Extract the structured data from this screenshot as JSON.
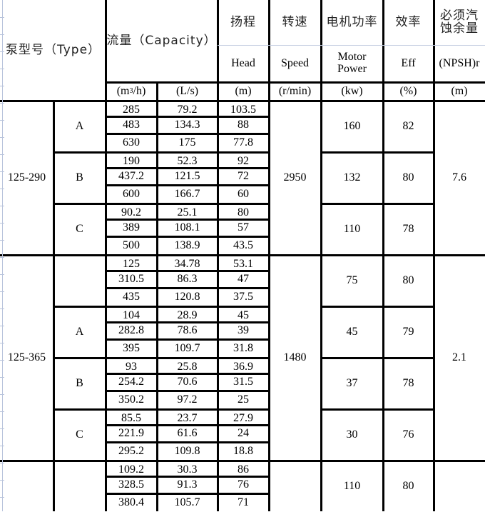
{
  "header": {
    "type_label": "泵型号（Type）",
    "capacity_label": "流量（Capacity）",
    "head_zh": "扬程",
    "speed_zh": "转速",
    "power_zh": "电机功率",
    "eff_zh": "效率",
    "npsh_zh_line1": "必须汽",
    "npsh_zh_line2": "蚀余量",
    "head_en": "Head",
    "speed_en": "Speed",
    "power_en_line1": "Motor",
    "power_en_line2": "Power",
    "eff_en": "Eff",
    "npsh_en": "(NPSH)r",
    "unit_capacity_m3h_pre": "(m",
    "unit_capacity_m3h_sup": "3",
    "unit_capacity_m3h_post": "/h)",
    "unit_capacity_ls": "(L/s)",
    "unit_head": "(m)",
    "unit_speed": "(r/min)",
    "unit_power": "(kw)",
    "unit_eff": "(%)",
    "unit_npsh": "(m)"
  },
  "models": [
    {
      "model": "125-290",
      "speed": "2950",
      "npsh": "7.6",
      "variants": [
        {
          "impeller": "A",
          "power": "160",
          "eff": "82",
          "rows": [
            [
              "285",
              "79.2",
              "103.5"
            ],
            [
              "483",
              "134.3",
              "88"
            ],
            [
              "630",
              "175",
              "77.8"
            ]
          ]
        },
        {
          "impeller": "B",
          "power": "132",
          "eff": "80",
          "rows": [
            [
              "190",
              "52.3",
              "92"
            ],
            [
              "437.2",
              "121.5",
              "72"
            ],
            [
              "600",
              "166.7",
              "60"
            ]
          ]
        },
        {
          "impeller": "C",
          "power": "110",
          "eff": "78",
          "rows": [
            [
              "90.2",
              "25.1",
              "80"
            ],
            [
              "389",
              "108.1",
              "57"
            ],
            [
              "500",
              "138.9",
              "43.5"
            ]
          ]
        }
      ]
    },
    {
      "model": "125-365",
      "speed": "1480",
      "npsh": "2.1",
      "variants": [
        {
          "impeller": "",
          "power": "75",
          "eff": "80",
          "rows": [
            [
              "125",
              "34.78",
              "53.1"
            ],
            [
              "310.5",
              "86.3",
              "47"
            ],
            [
              "435",
              "120.8",
              "37.5"
            ]
          ]
        },
        {
          "impeller": "A",
          "power": "45",
          "eff": "79",
          "rows": [
            [
              "104",
              "28.9",
              "45"
            ],
            [
              "282.8",
              "78.6",
              "39"
            ],
            [
              "395",
              "109.7",
              "31.8"
            ]
          ]
        },
        {
          "impeller": "B",
          "power": "37",
          "eff": "78",
          "rows": [
            [
              "93",
              "25.8",
              "36.9"
            ],
            [
              "254.2",
              "70.6",
              "31.5"
            ],
            [
              "350.2",
              "97.2",
              "25"
            ]
          ]
        },
        {
          "impeller": "C",
          "power": "30",
          "eff": "76",
          "rows": [
            [
              "85.5",
              "23.7",
              "27.9"
            ],
            [
              "221.9",
              "61.6",
              "24"
            ],
            [
              "295.2",
              "109.8",
              "18.8"
            ]
          ]
        }
      ]
    },
    {
      "model": "",
      "speed": "",
      "npsh": "",
      "variants": [
        {
          "impeller": "",
          "power": "110",
          "eff": "80",
          "rows": [
            [
              "109.2",
              "30.3",
              "86"
            ],
            [
              "328.5",
              "91.3",
              "76"
            ],
            [
              "380.4",
              "105.7",
              "71"
            ]
          ]
        }
      ]
    }
  ]
}
